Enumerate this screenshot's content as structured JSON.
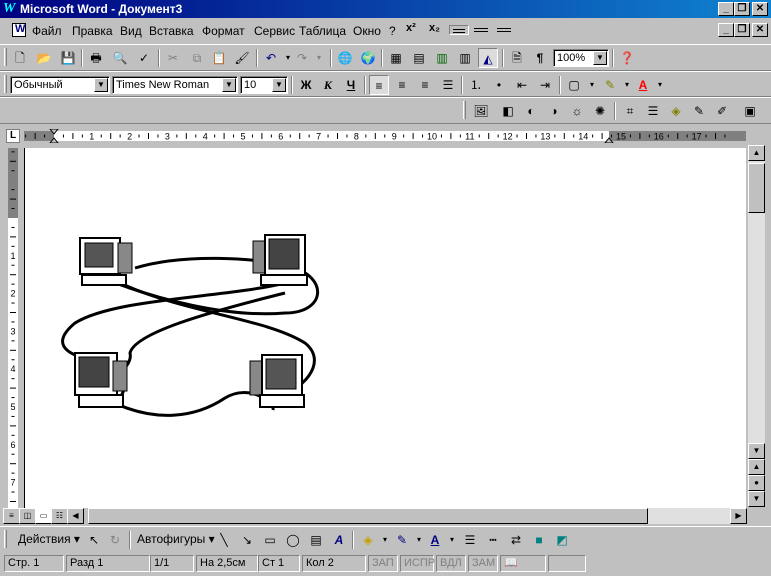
{
  "window": {
    "title": "Microsoft Word - Документ3",
    "app_icon": "word-icon",
    "minimize_label": "_",
    "maximize_label": "❐",
    "close_label": "✕"
  },
  "menubar": {
    "items": [
      "Файл",
      "Правка",
      "Вид",
      "Вставка",
      "Формат",
      "Сервис",
      "Таблица",
      "Окно",
      "?"
    ],
    "superscript": "x²",
    "subscript": "x₂"
  },
  "standard_toolbar": {
    "zoom": "100%",
    "icons": [
      "new-icon",
      "open-icon",
      "save-icon",
      "print-icon",
      "preview-icon",
      "spelling-icon",
      "cut-icon",
      "copy-icon",
      "paste-icon",
      "format-painter-icon",
      "undo-icon",
      "redo-icon",
      "hyperlink-icon",
      "web-toolbar-icon",
      "tables-borders-icon",
      "insert-table-icon",
      "insert-excel-icon",
      "columns-icon",
      "drawing-icon",
      "document-map-icon",
      "show-marks-icon",
      "help-icon"
    ]
  },
  "formatting_toolbar": {
    "style": "Обычный",
    "font": "Times New Roman",
    "size": "10",
    "bold": "Ж",
    "italic": "К",
    "underline": "Ч"
  },
  "ruler": {
    "corner": "L",
    "marks": [
      "1",
      "2",
      "3",
      "4",
      "5",
      "6",
      "7",
      "8",
      "9",
      "10",
      "11",
      "12",
      "13",
      "14",
      "15",
      "16",
      "17"
    ],
    "vmarks": [
      "1",
      "2",
      "3",
      "4",
      "5",
      "6",
      "7"
    ]
  },
  "drawing_toolbar": {
    "actions": "Действия",
    "autoshapes": "Автофигуры"
  },
  "statusbar": {
    "page": "Стр. 1",
    "section": "Разд 1",
    "pages": "1/1",
    "at": "На 2,5см",
    "line": "Ст 1",
    "col": "Кол 2",
    "rec": "ЗАП",
    "trk": "ИСПР",
    "ext": "ВДЛ",
    "ovr": "ЗАМ"
  }
}
